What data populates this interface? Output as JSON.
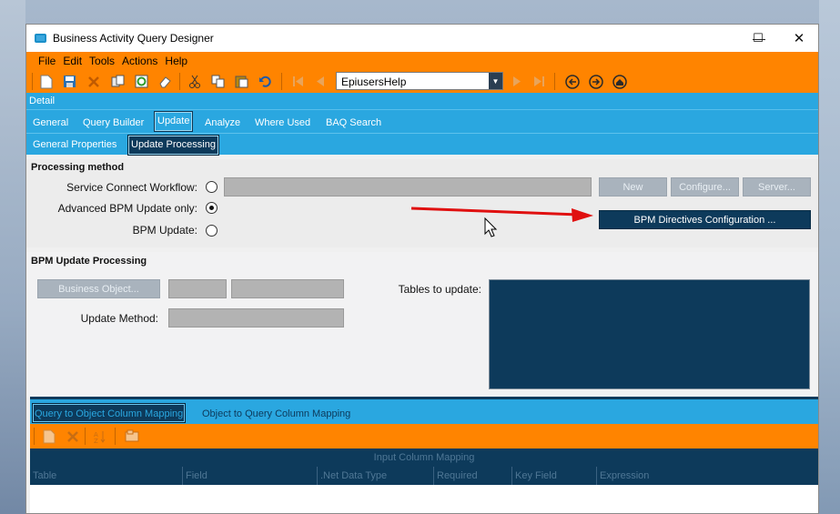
{
  "window": {
    "title": "Business Activity Query Designer",
    "minimize": "—",
    "maximize": "☐",
    "close": "✕"
  },
  "menu": [
    "File",
    "Edit",
    "Tools",
    "Actions",
    "Help"
  ],
  "toolbar": {
    "nav_value": "EpiusersHelp"
  },
  "detail_label": "Detail",
  "tabs": [
    "General",
    "Query Builder",
    "Update",
    "Analyze",
    "Where Used",
    "BAQ Search"
  ],
  "subtabs": [
    "General Properties",
    "Update  Processing"
  ],
  "processing": {
    "title": "Processing method",
    "service_label": "Service Connect Workflow:",
    "advanced_label": "Advanced BPM Update only:",
    "bpm_label": "BPM Update:",
    "selected": "advanced",
    "btn_new": "New",
    "btn_configure": "Configure...",
    "btn_server": "Server...",
    "btn_bpm_directives": "BPM Directives Configuration ..."
  },
  "bpm_update": {
    "title": "BPM Update Processing",
    "btn_business_object": "Business Object...",
    "update_method_label": "Update Method:",
    "tables_label": "Tables to update:"
  },
  "mapping": {
    "tab_query_to_object": "Query to Object Column Mapping",
    "tab_object_to_query": "Object to Query Column Mapping",
    "caption": "Input Column Mapping",
    "columns": [
      "Table",
      "Field",
      ".Net Data Type",
      "Required",
      "Key Field",
      "Expression"
    ]
  },
  "colors": {
    "orange": "#ff8400",
    "blue": "#2aa7e0",
    "navy": "#0d3a5b",
    "arrow_red": "#e01010"
  }
}
